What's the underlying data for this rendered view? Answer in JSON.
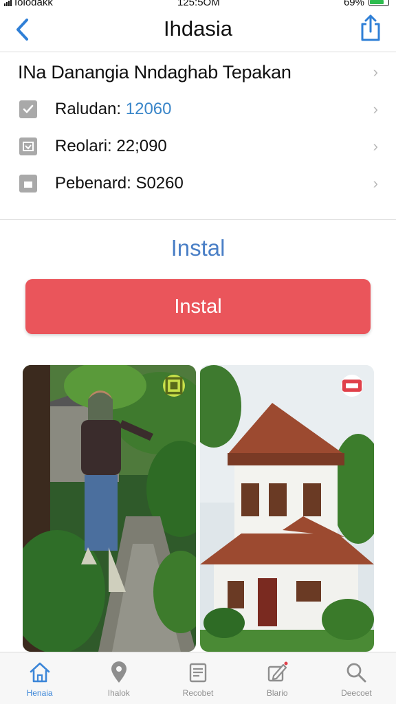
{
  "status_bar": {
    "carrier": "Iolodakk",
    "time": "125:5OM",
    "battery": "69%"
  },
  "nav": {
    "title": "Ihdasia"
  },
  "info": {
    "header": "INa Danangia Nndaghab Tepakan",
    "rows": [
      {
        "label": "Raludan:",
        "value": "12060",
        "value_color": "#3a86c9",
        "icon": "checkbox-icon"
      },
      {
        "label": "Reolari:",
        "value": "22;090",
        "value_color": "#111111",
        "icon": "image-icon"
      },
      {
        "label": "Pebenard:",
        "value": "S0260",
        "value_color": "#111111",
        "icon": "document-icon"
      }
    ]
  },
  "install": {
    "heading": "Instal",
    "button_label": "Instal",
    "button_color": "#ea555b"
  },
  "gallery": [
    {
      "badge_icon": "gallery-badge-icon"
    },
    {
      "badge_icon": "flag-badge-icon"
    }
  ],
  "tabs": [
    {
      "label": "Henaia",
      "icon": "home-icon",
      "active": true
    },
    {
      "label": "Ihalok",
      "icon": "location-pin-icon",
      "active": false
    },
    {
      "label": "Recobet",
      "icon": "notes-icon",
      "active": false
    },
    {
      "label": "Blario",
      "icon": "edit-icon",
      "active": false
    },
    {
      "label": "Deecoet",
      "icon": "search-icon",
      "active": false
    }
  ],
  "colors": {
    "accent": "#3c86d8",
    "heading_blue": "#4a7fc6",
    "cta": "#ea555b"
  }
}
